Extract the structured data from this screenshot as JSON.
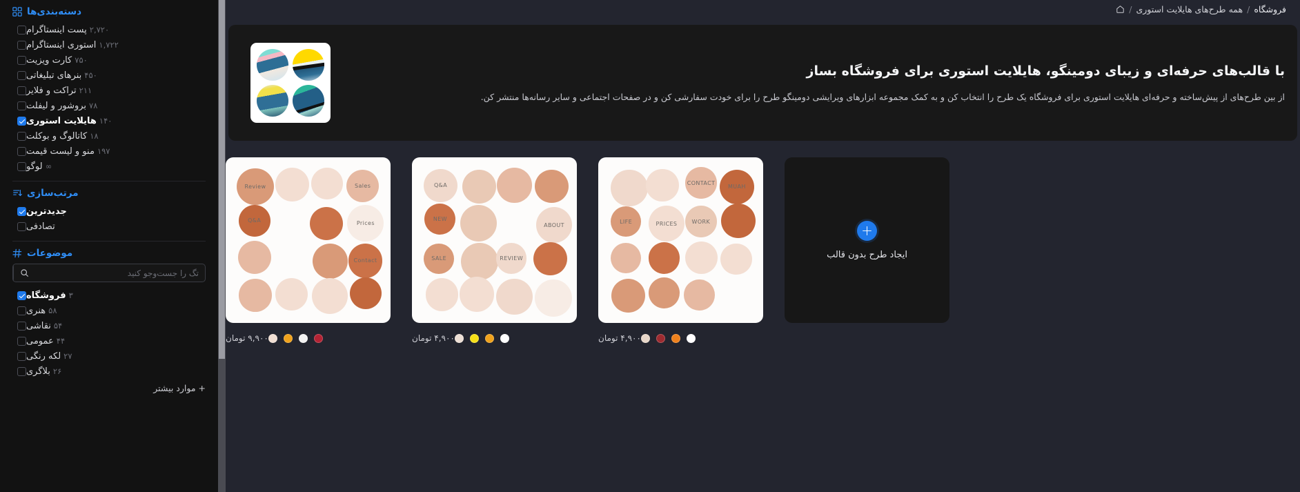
{
  "breadcrumb": {
    "home_icon": "home-icon",
    "items": [
      {
        "label": "فروشگاه",
        "current": true
      },
      {
        "label": "همه طرح‌های هایلایت استوری",
        "current": false
      }
    ],
    "separator": "/"
  },
  "hero": {
    "title": "با قالب‌های حرفه‌ای و زیبای دومینگو، هایلایت استوری برای فروشگاه بساز",
    "subtitle": "از بین طرح‌های از پیش‌ساخته و حرفه‌ای هایلایت استوری برای فروشگاه یک طرح را انتخاب کن و به کمک مجموعه ابزارهای ویرایشی دومینگو طرح را برای خودت سفارشی کن و در صفحات اجتماعی و سایر رسانه‌ها منتشر کن.",
    "thumbnail_name": "hero-thumbnail"
  },
  "cards": [
    {
      "name": "template-card-1",
      "price": "۹,۹۰۰ تومان",
      "swatches": [
        "#f0ded2",
        "#f0a21c",
        "#f2f2f2",
        "#b32334"
      ],
      "labels": [
        "Review",
        "Prices",
        "Contact",
        "Sales",
        "Q&A"
      ]
    },
    {
      "name": "template-card-2",
      "price": "۴,۹۰۰ تومان",
      "swatches": [
        "#eddfd5",
        "#f7e017",
        "#f0a21c",
        "#ffffff"
      ],
      "labels": [
        "Q&A",
        "NEW",
        "ABOUT",
        "SALE",
        "REVIEW"
      ]
    },
    {
      "name": "template-card-3",
      "price": "۴,۹۰۰ تومان",
      "swatches": [
        "#e7d6c8",
        "#9e2b30",
        "#f0811c",
        "#ffffff"
      ],
      "labels": [
        "CONTACT",
        "MUAH",
        "LIFE",
        "PRICES",
        "WORK"
      ]
    }
  ],
  "new_design_card": {
    "label": "ایجاد طرح بدون قالب",
    "icon": "plus-circle-icon"
  },
  "sidebar": {
    "categories": {
      "icon": "grid-icon",
      "title": "دسته‌بندی‌ها",
      "items": [
        {
          "label": "پست اینستاگرام",
          "count": "۲,۷۲۰",
          "checked": false
        },
        {
          "label": "استوری اینستاگرام",
          "count": "۱,۷۲۲",
          "checked": false
        },
        {
          "label": "کارت ویزیت",
          "count": "۷۵۰",
          "checked": false
        },
        {
          "label": "بنرهای تبلیغاتی",
          "count": "۴۵۰",
          "checked": false
        },
        {
          "label": "تراکت و فلایر",
          "count": "۲۱۱",
          "checked": false
        },
        {
          "label": "بروشور و لیفلت",
          "count": "۷۸",
          "checked": false
        },
        {
          "label": "هایلایت استوری",
          "count": "۱۴۰",
          "checked": true
        },
        {
          "label": "کاتالوگ و بوکلت",
          "count": "۱۸",
          "checked": false
        },
        {
          "label": "منو و لیست قیمت",
          "count": "۱۹۷",
          "checked": false
        },
        {
          "label": "لوگو",
          "count": "∞",
          "checked": false
        }
      ]
    },
    "sorting": {
      "icon": "sort-icon",
      "title": "مرتب‌سازی",
      "items": [
        {
          "label": "جدیدترین",
          "count": "",
          "checked": true
        },
        {
          "label": "تصادفی",
          "count": "",
          "checked": false
        }
      ]
    },
    "topics": {
      "icon": "hash-icon",
      "title": "موضوعات",
      "search_placeholder": "تگ را جست‌وجو کنید",
      "search_value": "",
      "search_icon": "search-icon",
      "items": [
        {
          "label": "فروشگاه",
          "count": "۳",
          "checked": true
        },
        {
          "label": "هنری",
          "count": "۵۸",
          "checked": false
        },
        {
          "label": "نقاشی",
          "count": "۵۴",
          "checked": false
        },
        {
          "label": "عمومی",
          "count": "۴۴",
          "checked": false
        },
        {
          "label": "لکه رنگی",
          "count": "۲۷",
          "checked": false
        },
        {
          "label": "بلاگری",
          "count": "۲۶",
          "checked": false
        }
      ],
      "more_label": "+ موارد بیشتر"
    }
  },
  "colors": {
    "accent": "#1f7aec",
    "link": "#2f8df5",
    "sidebar_bg": "#121212",
    "main_bg": "#23252f",
    "hero_bg": "#181818",
    "scrollbar_track": "#4a4b52",
    "scrollbar_thumb": "#9b9ca3"
  }
}
